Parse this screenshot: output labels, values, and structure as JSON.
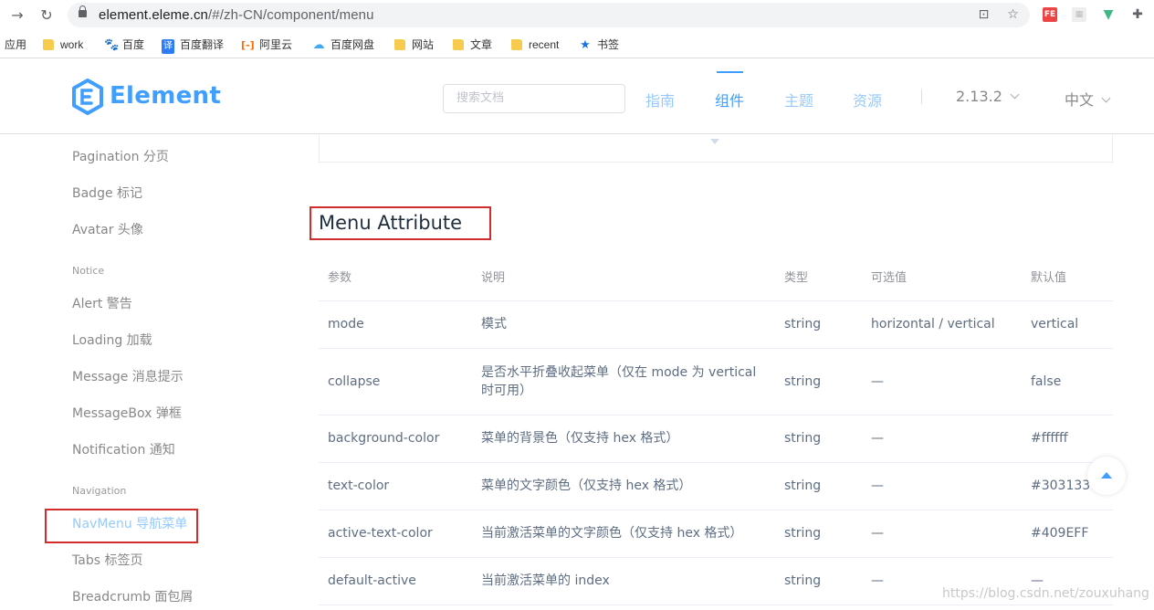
{
  "browser": {
    "url_host": "element.eleme.cn",
    "url_path": "/#/zh-CN/component/menu",
    "bookmarks": [
      "应用",
      "work",
      "百度",
      "百度翻译",
      "阿里云",
      "百度网盘",
      "网站",
      "文章",
      "recent",
      "书签"
    ]
  },
  "header": {
    "logo_text": "Element",
    "search_placeholder": "搜索文档",
    "nav": [
      "指南",
      "组件",
      "主题",
      "资源"
    ],
    "active_nav": "组件",
    "version": "2.13.2",
    "language": "中文",
    "accent_color": "#409eff"
  },
  "sidebar": {
    "items": [
      {
        "label": "Pagination 分页"
      },
      {
        "label": "Badge 标记"
      },
      {
        "label": "Avatar 头像"
      }
    ],
    "group_notice": "Notice",
    "notice_items": [
      {
        "label": "Alert 警告"
      },
      {
        "label": "Loading 加载"
      },
      {
        "label": "Message 消息提示"
      },
      {
        "label": "MessageBox 弹框"
      },
      {
        "label": "Notification 通知"
      }
    ],
    "group_navigation": "Navigation",
    "navigation_items": [
      {
        "label": "NavMenu 导航菜单"
      },
      {
        "label": "Tabs 标签页"
      },
      {
        "label": "Breadcrumb 面包屑"
      }
    ],
    "active_item": "NavMenu 导航菜单"
  },
  "main": {
    "section_title": "Menu Attribute",
    "table": {
      "headers": [
        "参数",
        "说明",
        "类型",
        "可选值",
        "默认值"
      ],
      "rows": [
        [
          "mode",
          "模式",
          "string",
          "horizontal / vertical",
          "vertical"
        ],
        [
          "collapse",
          "是否水平折叠收起菜单（仅在 mode 为 vertical 时可用）",
          "string",
          "—",
          "false"
        ],
        [
          "background-color",
          "菜单的背景色（仅支持 hex 格式）",
          "string",
          "—",
          "#ffffff"
        ],
        [
          "text-color",
          "菜单的文字颜色（仅支持 hex 格式）",
          "string",
          "—",
          "#303133"
        ],
        [
          "active-text-color",
          "当前激活菜单的文字颜色（仅支持 hex 格式）",
          "string",
          "—",
          "#409EFF"
        ],
        [
          "default-active",
          "当前激活菜单的 index",
          "string",
          "—",
          "—"
        ]
      ]
    }
  },
  "watermark": "https://blog.csdn.net/zouxuhang"
}
